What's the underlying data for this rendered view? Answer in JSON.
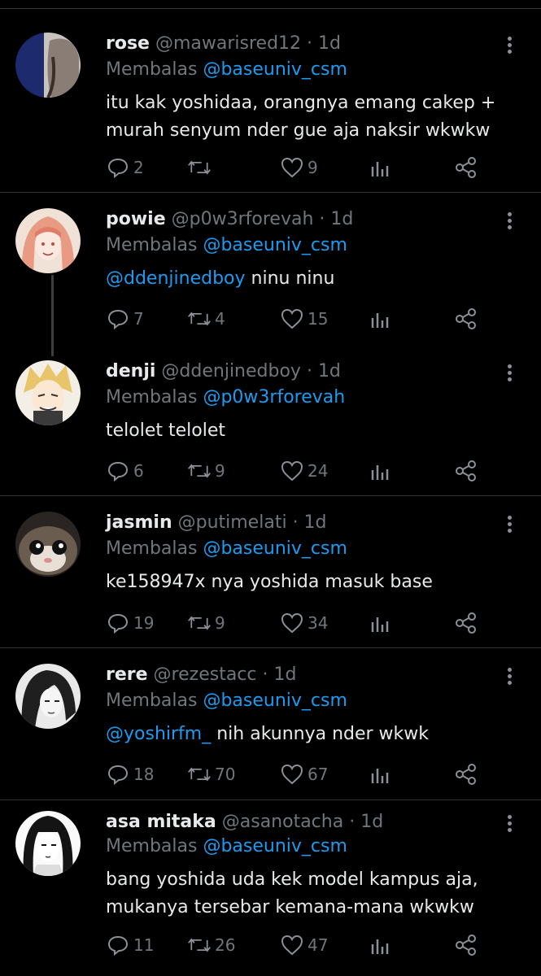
{
  "reply_prefix": "Membalas",
  "icons": {
    "reply": "speech-bubble-icon",
    "retweet": "retweet-icon",
    "like": "heart-icon",
    "views": "bar-chart-icon",
    "share": "share-icon",
    "more": "vertical-dots-icon"
  },
  "colors": {
    "background": "#000000",
    "link": "#1d9bf0",
    "muted": "#71767b",
    "text": "#e7e9ea"
  },
  "tweets": [
    {
      "name": "rose",
      "handle": "@mawarisred12",
      "time": "· 1d",
      "reply_to": "@baseuniv_csm",
      "lines": [
        "itu kak yoshidaa, orangnya emang cakep +",
        "murah senyum nder gue aja naksir wkwkw"
      ],
      "replies": "2",
      "retweets": "",
      "likes": "9"
    },
    {
      "name": "powie",
      "handle": "@p0w3rforevah",
      "time": "· 1d",
      "reply_to": "@baseuniv_csm",
      "mention": "@ddenjinedboy",
      "text": "ninu ninu",
      "replies": "7",
      "retweets": "4",
      "likes": "15"
    },
    {
      "name": "denji",
      "handle": "@ddenjinedboy",
      "time": "· 1d",
      "reply_to": "@p0w3rforevah",
      "text": "telolet telolet",
      "replies": "6",
      "retweets": "9",
      "likes": "24"
    },
    {
      "name": "jasmin",
      "handle": "@putimelati",
      "time": "· 1d",
      "reply_to": "@baseuniv_csm",
      "text": "ke158947x nya yoshida masuk base",
      "replies": "19",
      "retweets": "9",
      "likes": "34"
    },
    {
      "name": "rere",
      "handle": "@rezestacc",
      "time": "· 1d",
      "reply_to": "@baseuniv_csm",
      "mention": "@yoshirfm_",
      "text": "nih akunnya nder wkwk",
      "replies": "18",
      "retweets": "70",
      "likes": "67"
    },
    {
      "name": "asa mitaka",
      "handle": "@asanotacha",
      "time": "· 1d",
      "reply_to": "@baseuniv_csm",
      "lines": [
        "bang yoshida uda kek model kampus aja,",
        "mukanya tersebar kemana-mana wkwkw"
      ],
      "replies": "11",
      "retweets": "26",
      "likes": "47"
    }
  ]
}
